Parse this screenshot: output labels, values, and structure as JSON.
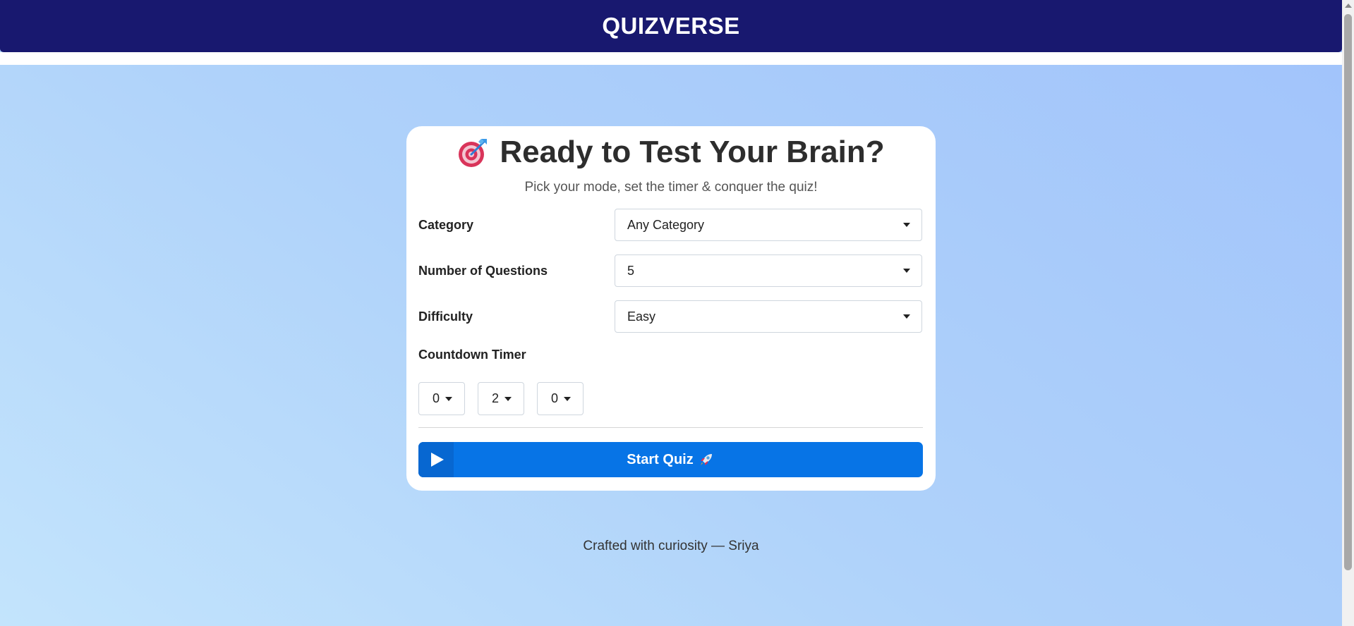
{
  "header": {
    "title": "QUIZVERSE"
  },
  "card": {
    "title": "Ready to Test Your Brain?",
    "title_icon": "target-icon",
    "subtitle": "Pick your mode, set the timer & conquer the quiz!"
  },
  "form": {
    "category": {
      "label": "Category",
      "value": "Any Category"
    },
    "num_questions": {
      "label": "Number of Questions",
      "value": "5"
    },
    "difficulty": {
      "label": "Difficulty",
      "value": "Easy"
    },
    "timer": {
      "label": "Countdown Timer",
      "values": [
        "0",
        "2",
        "0"
      ]
    }
  },
  "start_button": {
    "label": "Start Quiz",
    "icon": "play-icon",
    "trailing_icon": "rocket-icon"
  },
  "footer": {
    "text": "Crafted with curiosity — Sriya"
  },
  "colors": {
    "header_bg": "#18186f",
    "button_bg": "#0774e6",
    "page_gradient_start": "#c3e4fc",
    "page_gradient_end": "#a1c3fb"
  }
}
